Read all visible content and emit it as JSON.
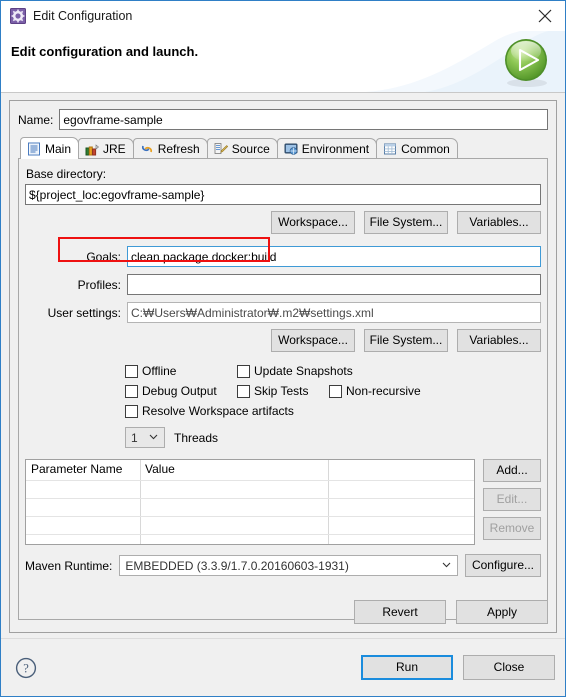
{
  "window": {
    "title": "Edit Configuration",
    "title_icon": "gear-icon",
    "close_icon": "close-icon"
  },
  "banner": {
    "heading": "Edit configuration and launch.",
    "icon": "run-green-play-icon"
  },
  "name_field": {
    "label": "Name:",
    "value": "egovframe-sample"
  },
  "tabs": [
    {
      "label": "Main",
      "icon": "main-document-icon",
      "active": true
    },
    {
      "label": "JRE",
      "icon": "jre-books-icon",
      "active": false
    },
    {
      "label": "Refresh",
      "icon": "refresh-arrows-icon",
      "active": false
    },
    {
      "label": "Source",
      "icon": "source-pencil-icon",
      "active": false
    },
    {
      "label": "Environment",
      "icon": "environment-monitor-icon",
      "active": false
    },
    {
      "label": "Common",
      "icon": "common-table-icon",
      "active": false
    }
  ],
  "main_tab": {
    "base_directory": {
      "label": "Base directory:",
      "value": "${project_loc:egovframe-sample}"
    },
    "dir_buttons": {
      "workspace": "Workspace...",
      "file_system": "File System...",
      "variables": "Variables..."
    },
    "goals": {
      "label": "Goals:",
      "value": "clean package docker:build",
      "highlighted": true,
      "highlight_color": "#ee1111",
      "focused": true
    },
    "profiles": {
      "label": "Profiles:",
      "value": ""
    },
    "user_settings": {
      "label": "User settings:",
      "value": "C:₩Users₩Administrator₩.m2₩settings.xml"
    },
    "settings_buttons": {
      "workspace": "Workspace...",
      "file_system": "File System...",
      "variables": "Variables..."
    },
    "checkboxes": [
      {
        "label": "Offline",
        "checked": false
      },
      {
        "label": "Update Snapshots",
        "checked": false
      },
      {
        "label": "Debug Output",
        "checked": false
      },
      {
        "label": "Skip Tests",
        "checked": false
      },
      {
        "label": "Non-recursive",
        "checked": false
      },
      {
        "label": "Resolve Workspace artifacts",
        "checked": false
      }
    ],
    "threads": {
      "value": "1",
      "label": "Threads"
    },
    "parameters_table": {
      "columns": [
        "Parameter Name",
        "Value",
        ""
      ],
      "rows": []
    },
    "table_buttons": {
      "add": "Add...",
      "edit": "Edit...",
      "remove": "Remove"
    },
    "maven_runtime": {
      "label": "Maven Runtime:",
      "value": "EMBEDDED (3.3.9/1.7.0.20160603-1931)",
      "configure": "Configure..."
    },
    "revert": "Revert",
    "apply": "Apply"
  },
  "footer": {
    "help_icon": "help-question-icon",
    "run": "Run",
    "close": "Close"
  },
  "colors": {
    "accent": "#1a8cdd",
    "dialog_border": "#2f7fc6",
    "annotation": "#ee1111",
    "panel_bg": "#f0f0f0"
  }
}
